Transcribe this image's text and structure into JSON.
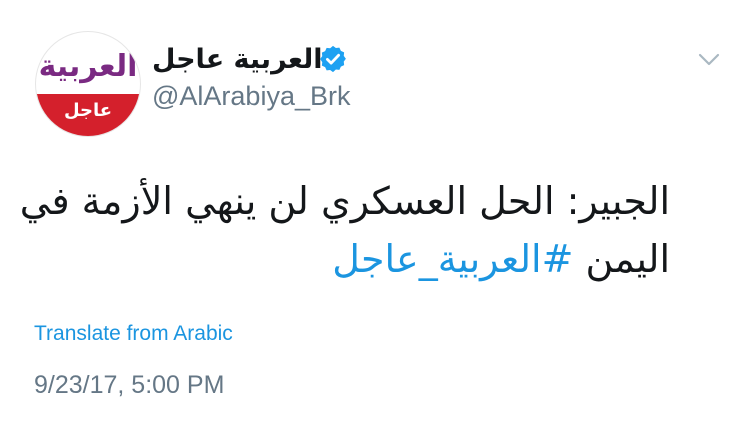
{
  "tweet": {
    "avatar": {
      "logo_text": "العربية",
      "band_text": "عاجل",
      "logo_color": "#7a2a82",
      "band_color": "#d4202c"
    },
    "display_name": "العربية عاجل",
    "verified": true,
    "verified_color": "#1da1f2",
    "handle": "@AlArabiya_Brk",
    "text_line_1": "الجبير: الحل العسكري لن ينهي الأزمة في",
    "text_line_2_plain": "اليمن ",
    "hashtag": "#العربية_عاجل",
    "translate_label": "Translate from Arabic",
    "timestamp": "9/23/17, 5:00 PM",
    "link_color": "#1b95e0"
  }
}
